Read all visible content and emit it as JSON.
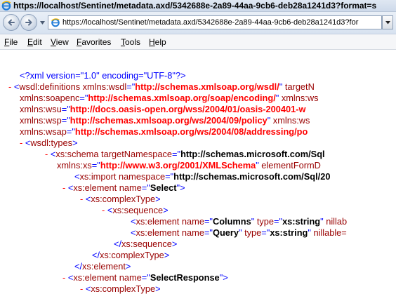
{
  "window": {
    "title": "https://localhost/Sentinet/metadata.axd/5342688e-2a89-44aa-9cb6-deb28a1241d3?format=s"
  },
  "addressbar": {
    "url": "https://localhost/Sentinet/metadata.axd/5342688e-2a89-44aa-9cb6-deb28a1241d3?for"
  },
  "menu": {
    "file": {
      "u": "F",
      "rest": "ile"
    },
    "edit": {
      "u": "E",
      "rest": "dit"
    },
    "view": {
      "u": "V",
      "rest": "iew"
    },
    "favorites": {
      "u": "F",
      "rest": "avorites"
    },
    "tools": {
      "u": "T",
      "rest": "ools"
    },
    "help": {
      "u": "H",
      "rest": "elp"
    }
  },
  "icons": {
    "back": "back-arrow-icon",
    "forward": "forward-arrow-icon",
    "page": "ie-page-icon",
    "collapse": "minus-collapse-icon"
  },
  "colors": {
    "tag": "#990000",
    "namespace_value": "#ff0000",
    "punctuation": "#0000ff",
    "collapse": "#ff0000"
  },
  "xml": {
    "decl": "<?xml version=\"1.0\" encoding=\"UTF-8\"?>",
    "l1": {
      "m": "-",
      "p1": "<",
      "t": "wsdl:definitions",
      "a1": " xmlns:wsdl",
      "eq1": "=\"",
      "v1": "http://schemas.xmlsoap.org/wsdl/",
      "q1": "\"",
      "a2": " targetN"
    },
    "l2": {
      "a": "xmlns:soapenc",
      "eq": "=\"",
      "v": "http://schemas.xmlsoap.org/soap/encoding/",
      "q": "\"",
      "a2": " xmlns:ws"
    },
    "l3": {
      "a": "xmlns:wsu",
      "eq": "=\"",
      "v": "http://docs.oasis-open.org/wss/2004/01/oasis-200401-w"
    },
    "l4": {
      "a": "xmlns:wsp",
      "eq": "=\"",
      "v": "http://schemas.xmlsoap.org/ws/2004/09/policy",
      "q": "\"",
      "a2": " xmlns:ws"
    },
    "l5": {
      "a": "xmlns:wsap",
      "eq": "=\"",
      "v": "http://schemas.xmlsoap.org/ws/2004/08/addressing/po"
    },
    "l6": {
      "m": "-",
      "p1": "<",
      "t": "wsdl:types",
      "p2": ">"
    },
    "l7": {
      "m": "-",
      "p1": "<",
      "t": "xs:schema",
      "a": " targetNamespace",
      "eq": "=\"",
      "v": "http://schemas.microsoft.com/Sql"
    },
    "l8": {
      "a": "xmlns:xs",
      "eq": "=\"",
      "v": "http://www.w3.org/2001/XMLSchema",
      "q": "\"",
      "a2": " elementFormD"
    },
    "l9": {
      "p1": "<",
      "t": "xs:import",
      "a": " namespace",
      "eq": "=\"",
      "v": "http://schemas.microsoft.com/Sql/20"
    },
    "l10": {
      "m": "-",
      "p1": "<",
      "t": "xs:element",
      "a": " name",
      "eq": "=\"",
      "v": "Select",
      "p2": "\">"
    },
    "l11": {
      "m": "-",
      "p1": "<",
      "t": "xs:complexType",
      "p2": ">"
    },
    "l12": {
      "m": "-",
      "p1": "<",
      "t": "xs:sequence",
      "p2": ">"
    },
    "l13": {
      "p1": "<",
      "t": "xs:element",
      "a": " name",
      "eq": "=\"",
      "v": "Columns",
      "q": "\"",
      "a2": " type",
      "eq2": "=\"",
      "v2": "xs:string",
      "q2": "\"",
      "a3": " nillab"
    },
    "l14": {
      "p1": "<",
      "t": "xs:element",
      "a": " name",
      "eq": "=\"",
      "v": "Query",
      "q": "\"",
      "a2": " type",
      "eq2": "=\"",
      "v2": "xs:string",
      "q2": "\"",
      "a3": " nillable="
    },
    "l15": {
      "p1": "</",
      "t": "xs:sequence",
      "p2": ">"
    },
    "l16": {
      "p1": "</",
      "t": "xs:complexType",
      "p2": ">"
    },
    "l17": {
      "p1": "</",
      "t": "xs:element",
      "p2": ">"
    },
    "l18": {
      "m": "-",
      "p1": "<",
      "t": "xs:element",
      "a": " name",
      "eq": "=\"",
      "v": "SelectResponse",
      "p2": "\">"
    },
    "l19": {
      "m": "-",
      "p1": "<",
      "t": "xs:complexType",
      "p2": ">"
    }
  }
}
